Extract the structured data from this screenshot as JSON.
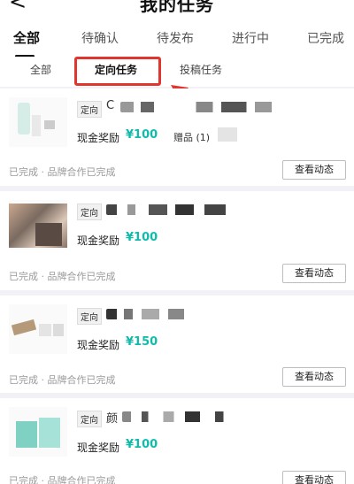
{
  "header": {
    "back_icon": "chevron-left-icon",
    "back_glyph": "<",
    "title": "我的任务"
  },
  "status_tabs": [
    "全部",
    "待确认",
    "待发布",
    "进行中",
    "已完成"
  ],
  "type_tabs": [
    "全部",
    "定向任务",
    "投稿任务"
  ],
  "highlight_color": "#e0362e",
  "accent_color": "#0fbcaa",
  "tasks": [
    {
      "tag": "定向",
      "title_first_char": "C",
      "reward_label": "现金奖励",
      "reward_value": "¥100",
      "gift": "赠品 (1)",
      "status": "已完成 · 品牌合作已完成",
      "action": "查看动态"
    },
    {
      "tag": "定向",
      "title_first_char": "",
      "reward_label": "现金奖励",
      "reward_value": "¥100",
      "status": "已完成 · 品牌合作已完成",
      "action": "查看动态"
    },
    {
      "tag": "定向",
      "title_first_char": "",
      "reward_label": "现金奖励",
      "reward_value": "¥150",
      "status": "已完成 · 品牌合作已完成",
      "action": "查看动态"
    },
    {
      "tag": "定向",
      "title_first_char": "颜",
      "reward_label": "现金奖励",
      "reward_value": "¥100",
      "status": "已完成 · 品牌合作已完成",
      "action": "查看动态"
    }
  ]
}
